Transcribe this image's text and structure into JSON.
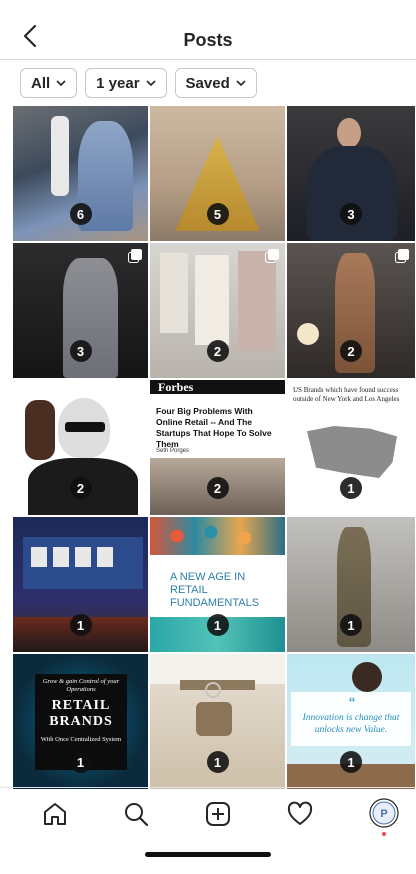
{
  "header": {
    "title": "Posts",
    "back_icon": "chevron-left-icon"
  },
  "filters": [
    {
      "label": "All"
    },
    {
      "label": "1 year"
    },
    {
      "label": "Saved"
    }
  ],
  "posts": [
    {
      "count": "6",
      "multi": false
    },
    {
      "count": "5",
      "multi": false
    },
    {
      "count": "3",
      "multi": false
    },
    {
      "count": "3",
      "multi": true
    },
    {
      "count": "2",
      "multi": true
    },
    {
      "count": "2",
      "multi": true
    },
    {
      "count": "2",
      "multi": false
    },
    {
      "count": "2",
      "multi": false,
      "masthead": "Forbes",
      "headline": "Four Big Problems With Online Retail -- And The Startups That Hope To Solve Them",
      "byline": "Seth Porges"
    },
    {
      "count": "1",
      "multi": false,
      "caption": "US Brands which have found success outside of New York and Los Angeles"
    },
    {
      "count": "1",
      "multi": false
    },
    {
      "count": "1",
      "multi": false,
      "caption": "A NEW AGE IN RETAIL FUNDAMENTALS"
    },
    {
      "count": "1",
      "multi": false
    },
    {
      "count": "1",
      "multi": false,
      "pre": "Grow & gain Control of your Operations",
      "caption": "RETAIL BRANDS",
      "post": "With Once Centralized System"
    },
    {
      "count": "1",
      "multi": false
    },
    {
      "count": "1",
      "multi": false,
      "caption": "Innovation is change that unlocks new Value."
    }
  ],
  "tabbar": {
    "items": [
      "home-icon",
      "search-icon",
      "create-icon",
      "heart-icon",
      "profile-icon"
    ]
  },
  "colors": {
    "accent": "#ed4956",
    "text": "#262626",
    "border": "#dbdbdb"
  }
}
